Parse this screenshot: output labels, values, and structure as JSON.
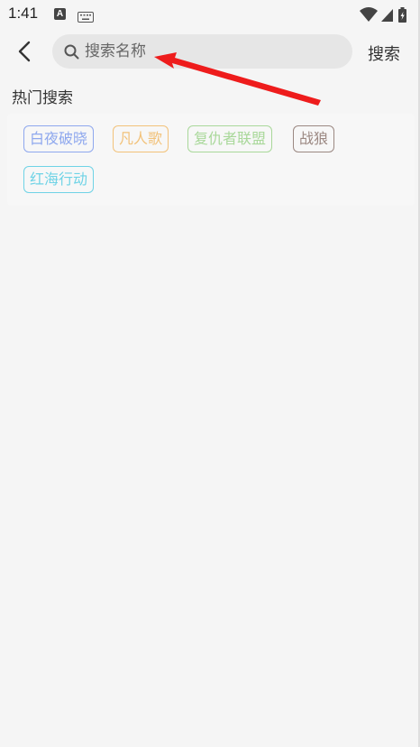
{
  "status_bar": {
    "time": "1:41",
    "icons": [
      "a-box-icon",
      "keyboard-icon",
      "wifi-icon",
      "signal-icon",
      "battery-icon"
    ]
  },
  "header": {
    "back_icon": "chevron-left-icon",
    "search_placeholder": "搜索名称",
    "search_value": "",
    "search_button": "搜索"
  },
  "hot_search": {
    "title": "热门搜索",
    "tags": [
      {
        "label": "白夜破晓",
        "color": "#8fa8ee"
      },
      {
        "label": "凡人歌",
        "color": "#f2c27a"
      },
      {
        "label": "复仇者联盟",
        "color": "#a9d89a"
      },
      {
        "label": "战狼",
        "color": "#9b8882"
      },
      {
        "label": "红海行动",
        "color": "#6fd3e6"
      }
    ]
  },
  "annotation": {
    "arrow_color": "#ee1c1c"
  }
}
